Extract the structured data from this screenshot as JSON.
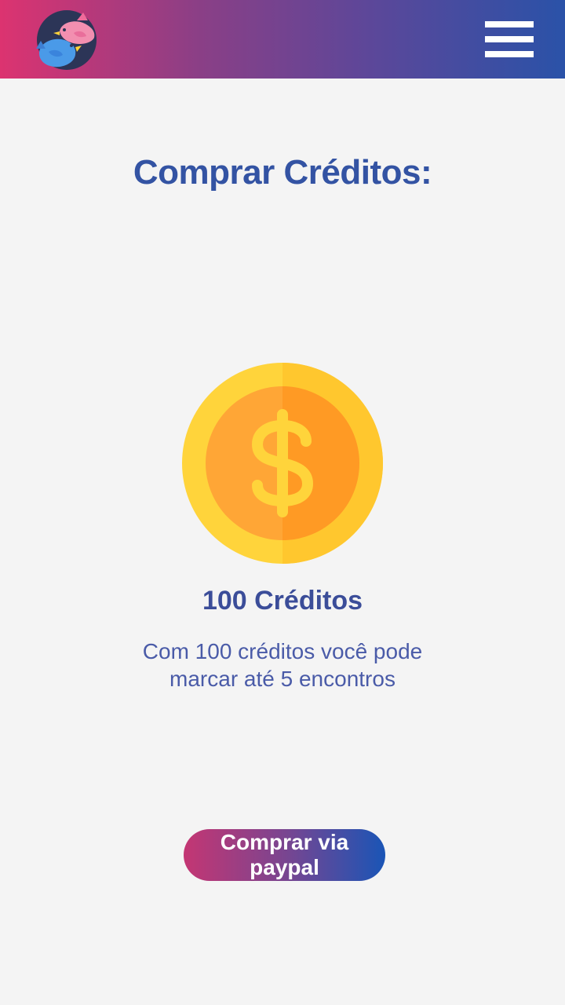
{
  "header": {
    "logo_icon": "birds-logo-icon",
    "menu_icon": "hamburger-menu-icon"
  },
  "page": {
    "title": "Comprar Créditos:"
  },
  "product": {
    "icon": "dollar-coin-icon",
    "title": "100 Créditos",
    "description": "Com 100 créditos você pode marcar até 5 encontros"
  },
  "actions": {
    "buy_label": "Comprar via paypal"
  },
  "colors": {
    "primary_text": "#3353a3",
    "coin_outer": "#ffd43b",
    "coin_inner": "#ffa030",
    "gradient_start": "#dc3370",
    "gradient_end": "#2a52a8"
  }
}
